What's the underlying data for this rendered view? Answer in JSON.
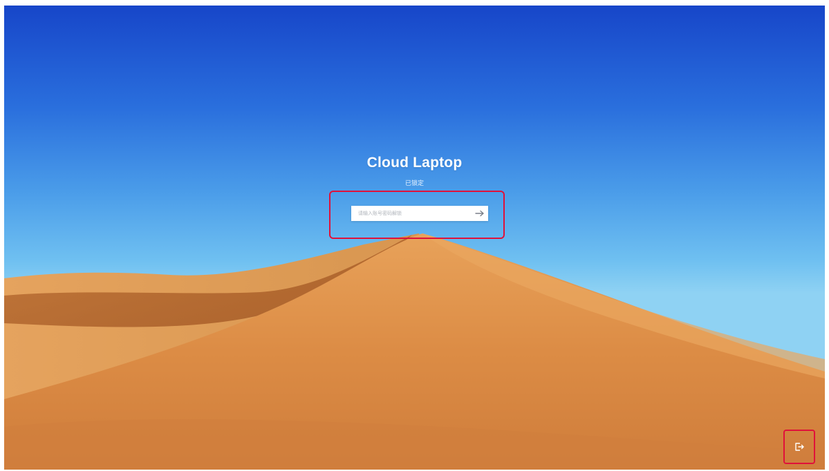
{
  "app": {
    "title": "Cloud Laptop",
    "status": "已锁定"
  },
  "login": {
    "placeholder": "请输入账号密码解锁",
    "value": "",
    "submit_icon": "arrow-right-icon"
  },
  "footer": {
    "exit_icon": "logout-icon"
  },
  "colors": {
    "highlight": "#e0113a",
    "sky_top": "#1746c9",
    "sky_bottom": "#8fd2f3",
    "sand": "#d98a43"
  }
}
